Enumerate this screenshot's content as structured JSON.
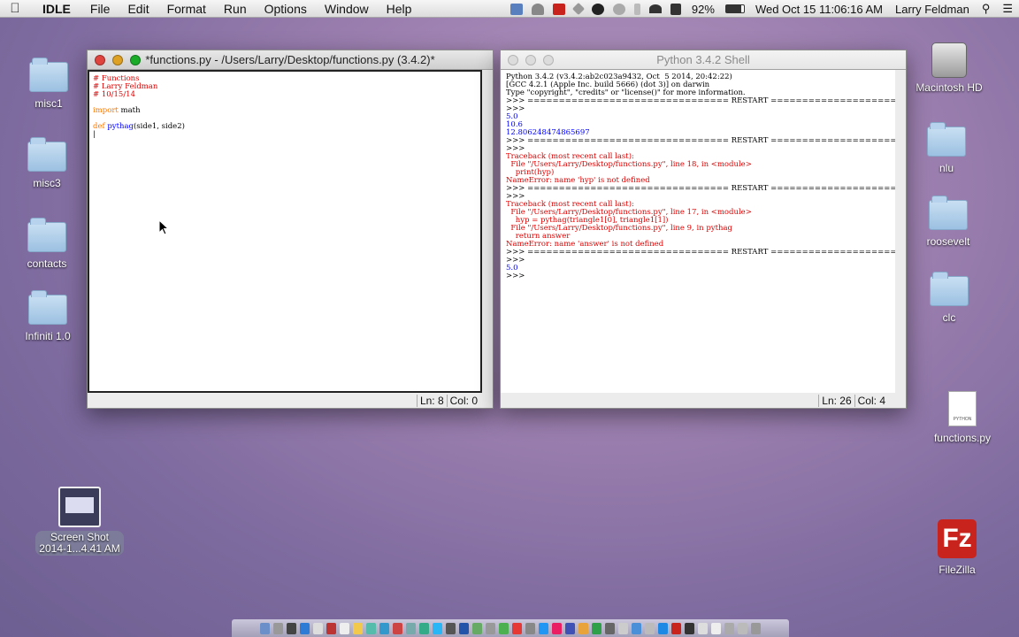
{
  "menubar": {
    "app_name": "IDLE",
    "menus": [
      "File",
      "Edit",
      "Format",
      "Run",
      "Options",
      "Window",
      "Help"
    ],
    "battery": "92%",
    "datetime": "Wed Oct 15  11:06:16 AM",
    "user": "Larry Feldman"
  },
  "desktop": {
    "left_icons": [
      {
        "label": "misc1"
      },
      {
        "label": "misc3"
      },
      {
        "label": "contacts"
      },
      {
        "label": "Infiniti 1.0"
      }
    ],
    "right_icons": [
      {
        "label": "Macintosh HD"
      },
      {
        "label": "nlu"
      },
      {
        "label": "roosevelt"
      },
      {
        "label": "clc"
      },
      {
        "label": "functions.py"
      },
      {
        "label": "FileZilla"
      }
    ],
    "screenshot_icon": {
      "line1": "Screen Shot",
      "line2": "2014-1...4.41 AM"
    },
    "python_file_caption": "PYTHON",
    "filezilla_glyph": "Fz"
  },
  "editor": {
    "title": "*functions.py - /Users/Larry/Desktop/functions.py (3.4.2)*",
    "lines": {
      "l1": "# Functions",
      "l2": "# Larry Feldman",
      "l3": "# 10/15/14",
      "l5_kw": "import",
      "l5_rest": " math",
      "l7_kw": "def",
      "l7_name": "pythag",
      "l7_rest": "(side1, side2)"
    },
    "status_ln": "Ln: 8",
    "status_col": "Col: 0"
  },
  "shell": {
    "title": "Python 3.4.2 Shell",
    "header": [
      "Python 3.4.2 (v3.4.2:ab2c023a9432, Oct  5 2014, 20:42:22)",
      "[GCC 4.2.1 (Apple Inc. build 5666) (dot 3)] on darwin",
      "Type \"copyright\", \"credits\" or \"license()\" for more information.",
      ">>> ================================ RESTART ================================",
      ">>> "
    ],
    "out1": [
      "5.0",
      "10.6",
      "12.806248474865697"
    ],
    "restart2": [
      ">>> ================================ RESTART ================================",
      ">>> "
    ],
    "err1": [
      "Traceback (most recent call last):",
      "  File \"/Users/Larry/Desktop/functions.py\", line 18, in <module>",
      "    print(hyp)",
      "NameError: name 'hyp' is not defined"
    ],
    "restart3": [
      ">>> ================================ RESTART ================================",
      ">>> "
    ],
    "err2": [
      "Traceback (most recent call last):",
      "  File \"/Users/Larry/Desktop/functions.py\", line 17, in <module>",
      "    hyp = pythag(triangle1[0], triangle1[1])",
      "  File \"/Users/Larry/Desktop/functions.py\", line 9, in pythag",
      "    return answer",
      "NameError: name 'answer' is not defined"
    ],
    "restart4": [
      ">>> ================================ RESTART ================================",
      ">>> "
    ],
    "out2": [
      "5.0"
    ],
    "prompt": ">>> ",
    "status_ln": "Ln: 26",
    "status_col": "Col: 4"
  }
}
